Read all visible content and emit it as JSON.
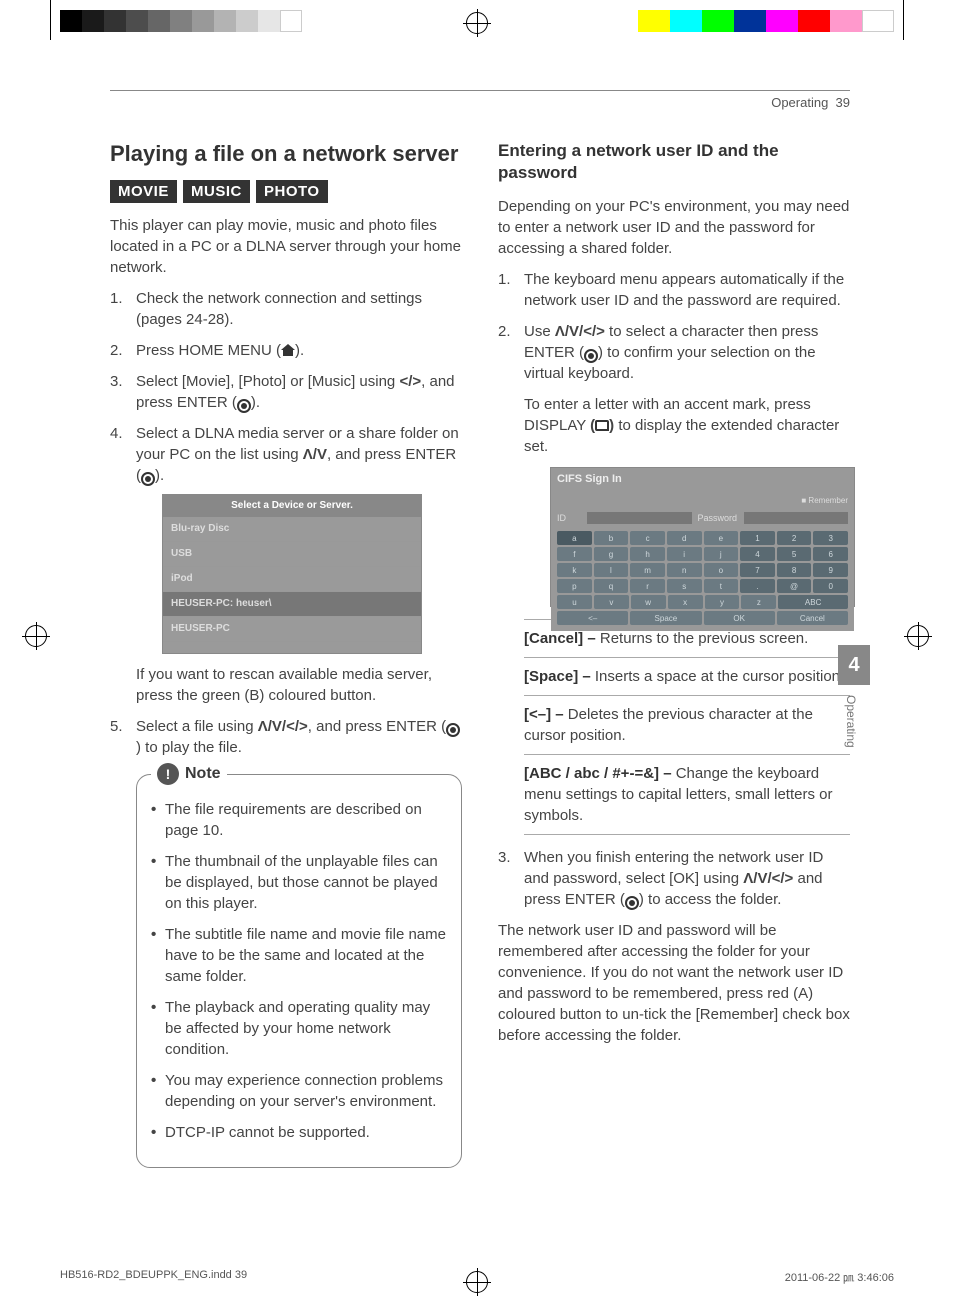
{
  "header": {
    "section": "Operating",
    "page": "39"
  },
  "left": {
    "title": "Playing a file on a network server",
    "tags": [
      "MOVIE",
      "MUSIC",
      "PHOTO"
    ],
    "intro": "This player can play movie, music and photo files located in a PC or a DLNA server through your home network.",
    "steps": [
      "Check the network connection and settings (pages 24-28).",
      "Press HOME MENU (",
      "Select [Movie], [Photo] or [Music] using ",
      "Select a DLNA media server or a share folder on your PC on the list using ",
      "Select a file using "
    ],
    "step2_tail": ").",
    "step3_mid": ", and press ENTER (",
    "step3_tail": ").",
    "step4_mid": ", and press ENTER (",
    "step4_tail": ").",
    "step5_mid": ", and press ENTER (",
    "step5_tail": ") to play the file.",
    "arrows_lr": "</>",
    "arrows_ud": "Λ/V",
    "arrows_all": "Λ/V/</>",
    "ui1": {
      "title": "Select a Device or Server.",
      "rows": [
        "Blu-ray Disc",
        "USB",
        "iPod",
        "HEUSER-PC: heuser\\",
        "HEUSER-PC"
      ]
    },
    "after_img": "If you want to rescan available media server, press the green (B) coloured button.",
    "note_title": "Note",
    "notes": [
      "The file requirements are described on page 10.",
      "The thumbnail of the unplayable files can be displayed, but those cannot be played on this player.",
      "The subtitle file name and movie file name have to be the same and located at the same folder.",
      "The playback and operating quality may be affected by your home network condition.",
      "You may experience connection problems depending on your server's environment.",
      "DTCP-IP cannot be supported."
    ]
  },
  "right": {
    "title": "Entering a network user ID and the password",
    "intro": "Depending on your PC's environment, you may need to enter a network user ID and the password for accessing a shared folder.",
    "step1": "The keyboard menu appears automatically if the network user ID and the password are required.",
    "step2a": "Use ",
    "step2b": " to select a character then press ENTER (",
    "step2c": ") to confirm your selection on the virtual keyboard.",
    "step2_extra_a": "To enter a letter with an accent mark, press DISPLAY ",
    "step2_extra_b": " to display the extended character set.",
    "ui2": {
      "title": "CIFS Sign In",
      "id": "ID",
      "password": "Password",
      "remember": "Remember",
      "kb": [
        [
          "a",
          "b",
          "c",
          "d",
          "e",
          "1",
          "2",
          "3"
        ],
        [
          "f",
          "g",
          "h",
          "i",
          "j",
          "4",
          "5",
          "6"
        ],
        [
          "k",
          "l",
          "m",
          "n",
          "o",
          "7",
          "8",
          "9"
        ],
        [
          "p",
          "q",
          "r",
          "s",
          "t",
          ".",
          "@",
          "0"
        ],
        [
          "u",
          "v",
          "w",
          "x",
          "y",
          "z",
          "ABC"
        ]
      ],
      "bottom": [
        "<–",
        "Space",
        "OK",
        "Cancel"
      ]
    },
    "defs": [
      {
        "k": "[Cancel] –",
        "v": " Returns to the previous screen."
      },
      {
        "k": "[Space] –",
        "v": " Inserts a space at the cursor position."
      },
      {
        "k": "[<–] –",
        "v": " Deletes the previous character at the cursor position."
      },
      {
        "k": "[ABC / abc / #+-=&] –",
        "v": " Change the keyboard menu settings to capital letters, small letters or symbols."
      }
    ],
    "step3a": "When you finish entering the network user ID and password, select [OK] using ",
    "step3b": " and press ENTER (",
    "step3c": ") to access the folder.",
    "outro": "The network user ID and password will be remembered after accessing the folder for your convenience. If you do not want the network user ID and password to be remembered, press red (A) coloured button to un-tick the [Remember] check box before accessing the folder."
  },
  "side": {
    "num": "4",
    "label": "Operating"
  },
  "footer": {
    "file": "HB516-RD2_BDEUPPK_ENG.indd   39",
    "ts": "2011-06-22   ㏘ 3:46:06"
  }
}
